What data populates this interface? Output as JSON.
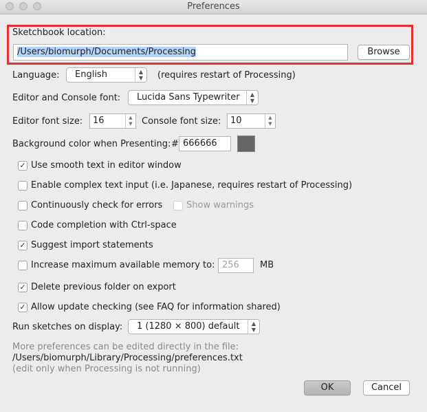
{
  "window": {
    "title": "Preferences"
  },
  "sketchbook": {
    "label": "Sketchbook location:",
    "path": "/Users/biomurph/Documents/Processing",
    "browse_label": "Browse"
  },
  "language": {
    "label": "Language:",
    "value": "English",
    "note": "(requires restart of Processing)"
  },
  "editor_font": {
    "label": "Editor and Console font:",
    "value": "Lucida Sans Typewriter"
  },
  "font_sizes": {
    "editor_label": "Editor font size:",
    "editor_value": "16",
    "console_label": "Console font size:",
    "console_value": "10"
  },
  "background": {
    "label": "Background color when Presenting:",
    "hash": "#",
    "value": "666666",
    "color": "#666666"
  },
  "options": {
    "smooth_text": {
      "label": "Use smooth text in editor window",
      "checked": true
    },
    "complex_input": {
      "label": "Enable complex text input (i.e. Japanese, requires restart of Processing)",
      "checked": false
    },
    "check_errors": {
      "label": "Continuously check for errors",
      "checked": false
    },
    "show_warnings": {
      "label": "Show warnings",
      "checked": false,
      "enabled": false
    },
    "code_completion": {
      "label": "Code completion with Ctrl-space",
      "checked": false
    },
    "suggest_imports": {
      "label": "Suggest import statements",
      "checked": true
    },
    "increase_memory": {
      "label": "Increase maximum available memory to:",
      "checked": false,
      "value": "256",
      "unit": "MB"
    },
    "delete_previous": {
      "label": "Delete previous folder on export",
      "checked": true
    },
    "update_check": {
      "label": "Allow update checking (see FAQ for information shared)",
      "checked": true
    }
  },
  "display": {
    "label": "Run sketches on display:",
    "value": "1 (1280 × 800) default"
  },
  "footer": {
    "more_text": "More preferences can be edited directly in the file:",
    "file_path": "/Users/biomurph/Library/Processing/preferences.txt",
    "note": "(edit only when Processing is not running)"
  },
  "buttons": {
    "ok": "OK",
    "cancel": "Cancel"
  },
  "colors": {
    "highlight_border": "#e53030",
    "selection": "#b3d4fc"
  }
}
